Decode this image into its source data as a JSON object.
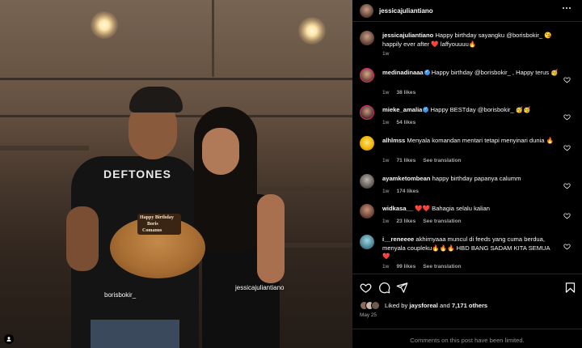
{
  "post": {
    "band_text": "DEFTONES",
    "cake_lines": [
      "Happy Birthday",
      "Boris",
      "Comanus"
    ],
    "tags": {
      "left": "borisbokir_",
      "right": "jessicajuliantiano"
    }
  },
  "header": {
    "username": "jessicajuliantiano"
  },
  "caption": {
    "username": "jessicajuliantiano",
    "text": "Happy birthday sayangku @borisbokir_ 😘 happily ever after ❤️ laffyouuuu🔥",
    "time": "1w"
  },
  "comments": [
    {
      "username": "medinadinaaa",
      "verified": true,
      "text": "Happy birthday @borisbokir_ , Happy terus 🥳",
      "time": "1w",
      "likes": "38 likes",
      "translation": ""
    },
    {
      "username": "mieke_amalia",
      "verified": true,
      "text": "Happy BESTday @borisbokir_ 🥳🥳",
      "time": "1w",
      "likes": "54 likes",
      "translation": ""
    },
    {
      "username": "alhlmss",
      "verified": false,
      "text": "Menyala komandan mentari tetapi menyinari dunia 🔥",
      "time": "1w",
      "likes": "71 likes",
      "translation": "See translation"
    },
    {
      "username": "ayamketombean",
      "verified": false,
      "text": "happy birthday papanya calumm",
      "time": "1w",
      "likes": "174 likes",
      "translation": ""
    },
    {
      "username": "widkasa__",
      "verified": false,
      "text": "❤️❤️ Bahagia selalu kalian",
      "time": "1w",
      "likes": "23 likes",
      "translation": "See translation"
    },
    {
      "username": "i__reneeee",
      "verified": false,
      "text": "akhirnyaaa muncul di feeds yang cuma berdua, menyala coupleku🔥🔥🔥 HBD BANG SADAM KITA SEMUA ❤️",
      "time": "1w",
      "likes": "99 likes",
      "translation": "See translation"
    }
  ],
  "likes": {
    "prefix": "Liked by",
    "user": "jaysforeal",
    "and": "and",
    "count": "7,171 others"
  },
  "date": "May 25",
  "limited_notice": "Comments on this post have been limited.",
  "colors": {
    "verified": "#3897f0",
    "heart": "#ed4956",
    "muted": "#a8a8a8"
  }
}
